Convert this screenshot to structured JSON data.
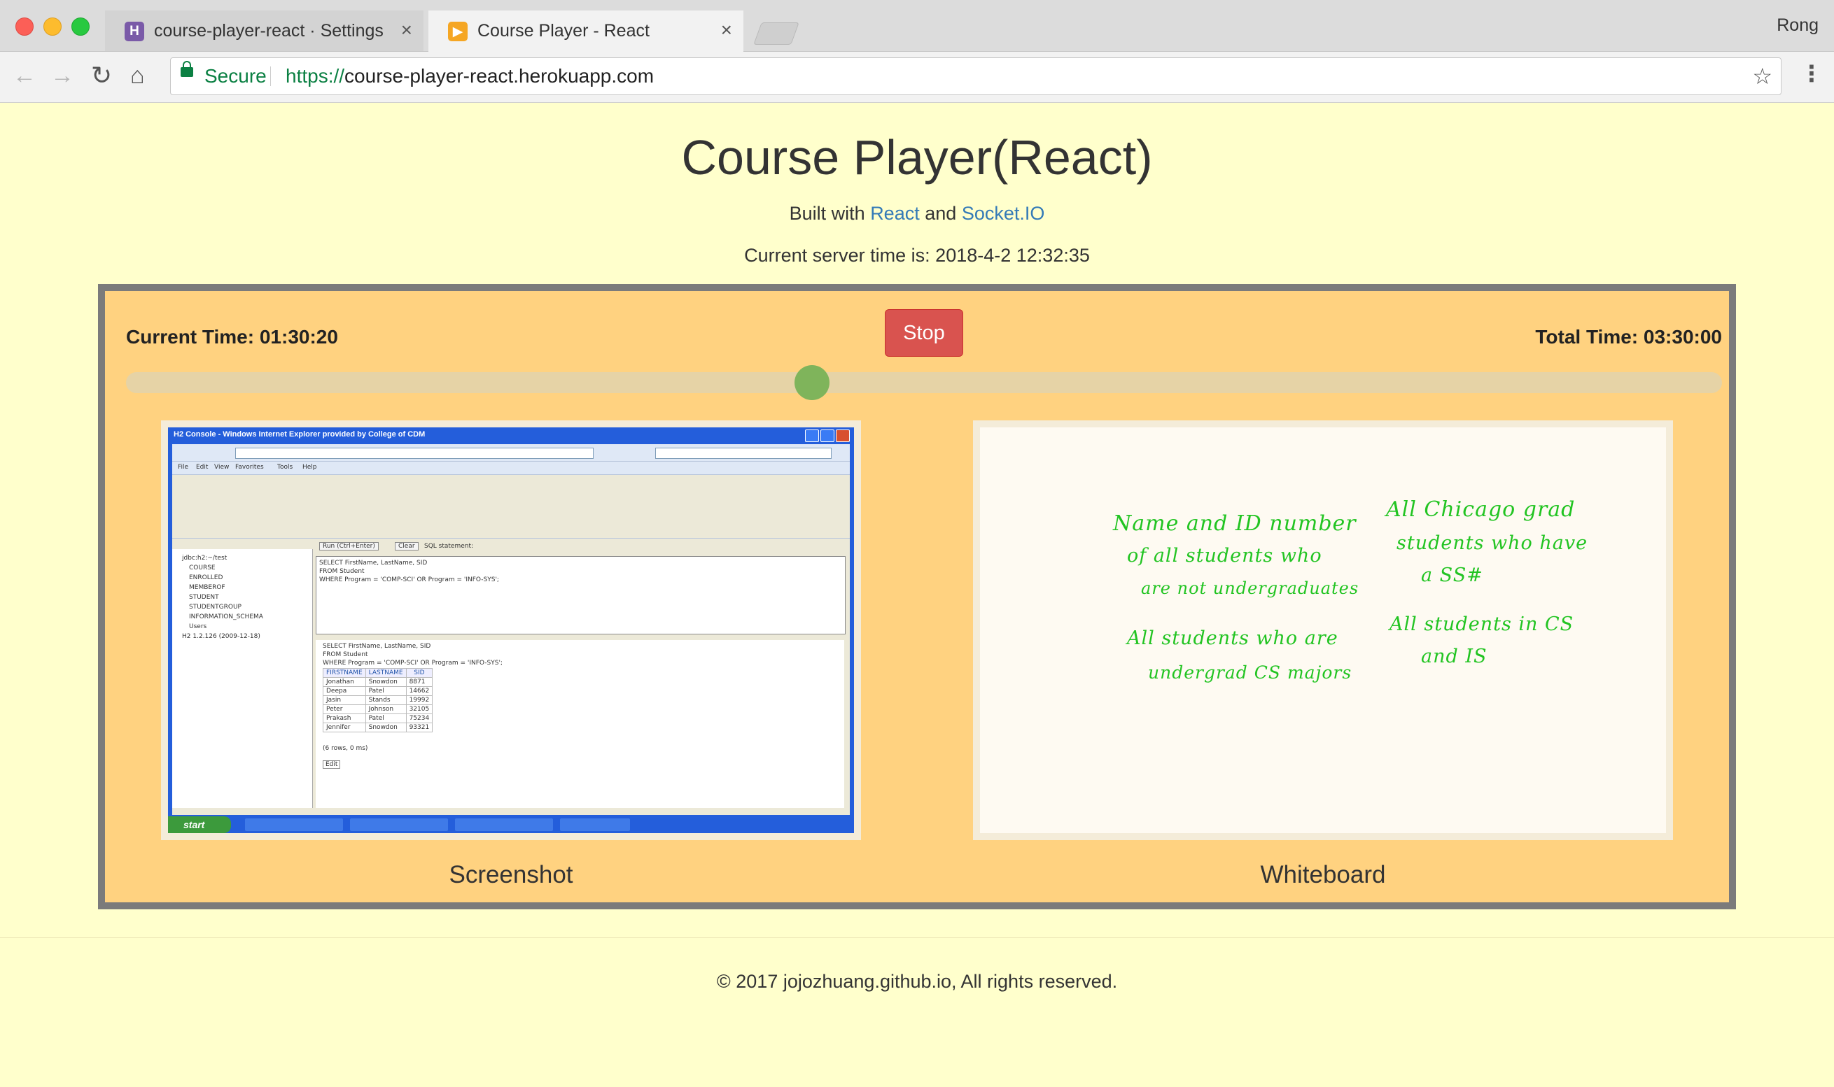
{
  "browser": {
    "tabs": [
      {
        "title": "course-player-react · Settings",
        "favicon": "heroku-icon",
        "active": false
      },
      {
        "title": "Course Player - React",
        "favicon": "play-icon",
        "active": true
      }
    ],
    "profile": "Rong",
    "secure_label": "Secure",
    "url_scheme": "https://",
    "url_rest": "course-player-react.herokuapp.com"
  },
  "header": {
    "title": "Course Player(React)",
    "built_prefix": "Built with",
    "link_react": "React",
    "and": "and",
    "link_socketio": "Socket.IO",
    "server_time": "Current server time is: 2018-4-2 12:32:35"
  },
  "player": {
    "current_time": "Current Time: 01:30:20",
    "total_time": "Total Time: 03:30:00",
    "stop_label": "Stop",
    "progress": 0.43,
    "screenshot_label": "Screenshot",
    "whiteboard_label": "Whiteboard"
  },
  "screenshot": {
    "window_title": "H2 Console - Windows Internet Explorer provided by College of CDM",
    "menu": [
      "File",
      "Edit",
      "View",
      "Favorites",
      "Tools",
      "Help"
    ],
    "tree": [
      "jdbc:h2:~/test",
      "COURSE",
      "ENROLLED",
      "MEMBEROF",
      "STUDENT",
      "STUDENTGROUP",
      "INFORMATION_SCHEMA",
      "Users",
      "H2 1.2.126 (2009-12-18)"
    ],
    "run_label": "Run (Ctrl+Enter)",
    "clear_label": "Clear",
    "sql_label": "SQL statement:",
    "sql": [
      "SELECT FirstName, LastName, SID",
      "FROM Student",
      "WHERE Program = 'COMP-SCI' OR Program = 'INFO-SYS';"
    ],
    "columns": [
      "FIRSTNAME",
      "LASTNAME",
      "SID"
    ],
    "rows": [
      [
        "Jonathan",
        "Snowdon",
        "8871"
      ],
      [
        "Deepa",
        "Patel",
        "14662"
      ],
      [
        "Jasin",
        "Stands",
        "19992"
      ],
      [
        "Peter",
        "Johnson",
        "32105"
      ],
      [
        "Prakash",
        "Patel",
        "75234"
      ],
      [
        "Jennifer",
        "Snowdon",
        "93321"
      ]
    ],
    "row_count": "(6 rows, 0 ms)",
    "edit_label": "Edit",
    "start_label": "start"
  },
  "whiteboard": {
    "lines": [
      "Name and ID number",
      "of all students who",
      "are not undergraduates",
      "All students who are",
      "undergrad CS majors",
      "All Chicago grad",
      "students who have",
      "a SS#",
      "All students in CS",
      "and IS"
    ],
    "ink_color": "#22c422"
  },
  "footer": {
    "text": "© 2017 jojozhuang.github.io, All rights reserved."
  },
  "colors": {
    "page_bg": "#ffffcc",
    "player_bg": "#ffd280",
    "player_border": "#7b7b7b",
    "stop_button": "#d9534f",
    "slider_thumb": "#7fb45b",
    "link": "#337ab7"
  }
}
